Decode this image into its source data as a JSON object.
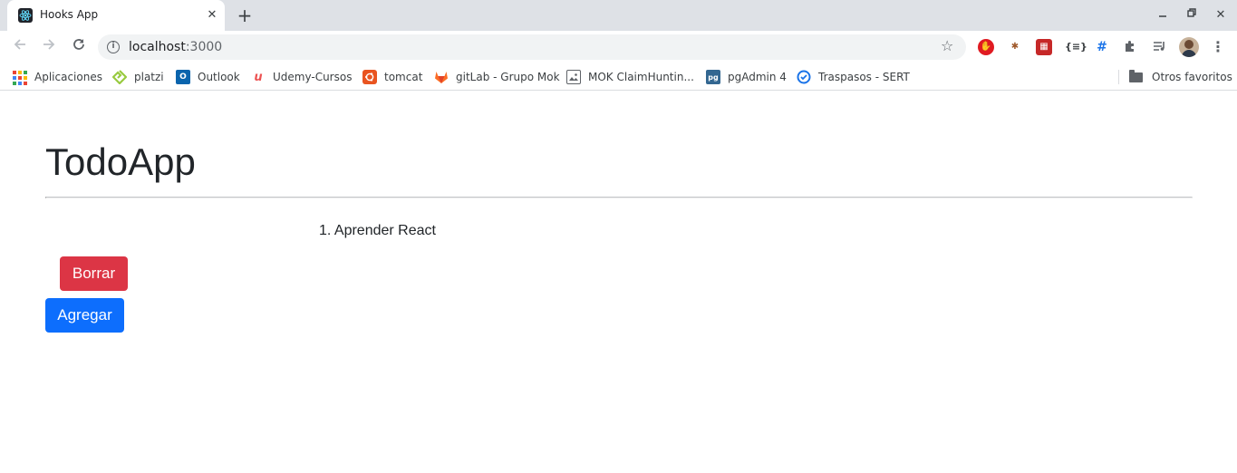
{
  "browser": {
    "tab": {
      "title": "Hooks App"
    },
    "url": {
      "host": "localhost",
      "port": ":3000"
    },
    "bookmarks": [
      {
        "label": "Aplicaciones",
        "icon": "apps-grid-icon"
      },
      {
        "label": "platzi",
        "icon": "platzi-icon",
        "color": "#98ca3f"
      },
      {
        "label": "Outlook",
        "icon": "outlook-icon",
        "color": "#0a64ad"
      },
      {
        "label": "Udemy-Cursos",
        "icon": "udemy-icon",
        "color": "#ec5252"
      },
      {
        "label": "tomcat",
        "icon": "ubuntu-icon",
        "color": "#e95420"
      },
      {
        "label": "gitLab - Grupo Mok",
        "icon": "gitlab-icon",
        "color": "#fc6d26"
      },
      {
        "label": "MOK ClaimHuntin...",
        "icon": "image-icon",
        "color": "#5f6368"
      },
      {
        "label": "pgAdmin 4",
        "icon": "pgadmin-icon",
        "color": "#336791"
      },
      {
        "label": "Traspasos - SERT",
        "icon": "sert-icon",
        "color": "#1a73e8"
      }
    ],
    "other_bookmarks": "Otros favoritos"
  },
  "app": {
    "title": "TodoApp",
    "todos": [
      "1. Aprender React"
    ],
    "delete_button": "Borrar",
    "add_button": "Agregar"
  },
  "colors": {
    "danger": "#dc3545",
    "primary": "#0d6efd"
  }
}
